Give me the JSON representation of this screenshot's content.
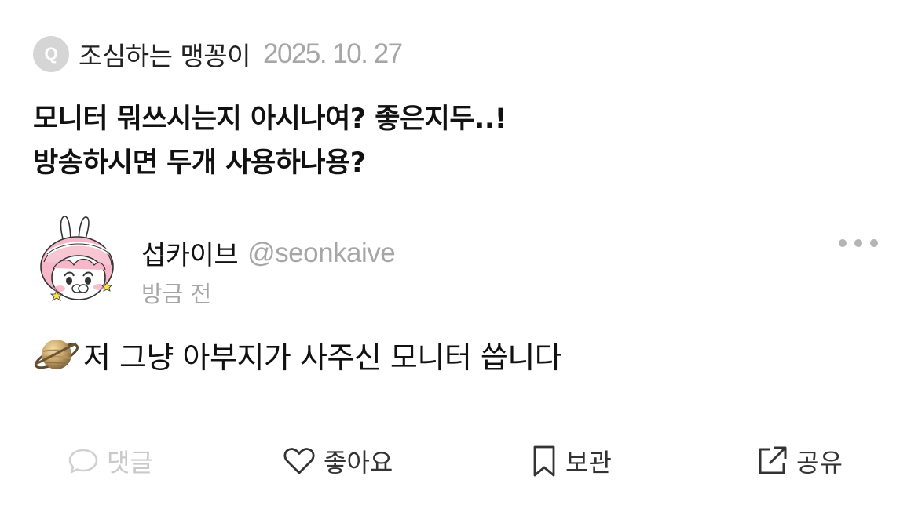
{
  "question": {
    "badge": "Q",
    "asker": "조심하는 맹꽁이",
    "date": "2025. 10. 27",
    "lines": [
      "모니터 뭐쓰시는지 아시나여? 좋은지두..!",
      "방송하시면 두개 사용하나용?"
    ]
  },
  "answer": {
    "author_name": "섭카이브",
    "author_handle": "@seonkaive",
    "time": "방금 전",
    "emoji_icon": "ringed-planet-icon",
    "text": "저 그냥 아부지가 사주신 모니터 씁니다"
  },
  "actions": {
    "comment": {
      "label": "댓글",
      "icon": "speech-bubble-icon",
      "enabled": false
    },
    "like": {
      "label": "좋아요",
      "icon": "heart-icon",
      "enabled": true
    },
    "save": {
      "label": "보관",
      "icon": "bookmark-icon",
      "enabled": true
    },
    "share": {
      "label": "공유",
      "icon": "share-external-icon",
      "enabled": true
    }
  },
  "colors": {
    "primary_text": "#111111",
    "secondary_text": "#a6a6a6",
    "disabled": "#c9c9c9",
    "badge": "#d5d5d5"
  }
}
